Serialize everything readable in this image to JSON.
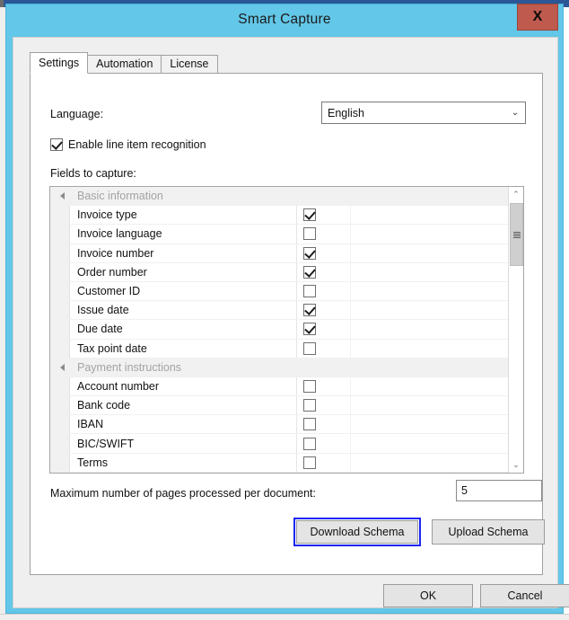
{
  "window": {
    "title": "Smart Capture",
    "close_label": "X",
    "frame_color": "#62c7e8",
    "close_button_color": "#bf5a4e"
  },
  "tabs": [
    {
      "label": "Settings",
      "active": true
    },
    {
      "label": "Automation",
      "active": false
    },
    {
      "label": "License",
      "active": false
    }
  ],
  "settings": {
    "language_label": "Language:",
    "language_value": "English",
    "language_arrow": "⌄",
    "enable_line_item_label": "Enable line item recognition",
    "enable_line_item_checked": true,
    "fields_label": "Fields to capture:",
    "maxpages_label": "Maximum number of pages processed per document:",
    "maxpages_value": "5",
    "download_schema_label": "Download Schema",
    "upload_schema_label": "Upload Schema",
    "focus_ring_color": "#1d24f0"
  },
  "field_list": {
    "rows": [
      {
        "type": "group",
        "label": "Basic information"
      },
      {
        "type": "item",
        "label": "Invoice type",
        "checked": true
      },
      {
        "type": "item",
        "label": "Invoice language",
        "checked": false
      },
      {
        "type": "item",
        "label": "Invoice number",
        "checked": true
      },
      {
        "type": "item",
        "label": "Order number",
        "checked": true
      },
      {
        "type": "item",
        "label": "Customer ID",
        "checked": false
      },
      {
        "type": "item",
        "label": "Issue date",
        "checked": true
      },
      {
        "type": "item",
        "label": "Due date",
        "checked": true
      },
      {
        "type": "item",
        "label": "Tax point date",
        "checked": false
      },
      {
        "type": "group",
        "label": "Payment instructions"
      },
      {
        "type": "item",
        "label": "Account number",
        "checked": false
      },
      {
        "type": "item",
        "label": "Bank code",
        "checked": false
      },
      {
        "type": "item",
        "label": "IBAN",
        "checked": false
      },
      {
        "type": "item",
        "label": "BIC/SWIFT",
        "checked": false
      },
      {
        "type": "item",
        "label": "Terms",
        "checked": false
      },
      {
        "type": "item",
        "label": "",
        "checked": false
      }
    ],
    "scrollbar": {
      "up_arrow": "⌃",
      "down_arrow": "⌄"
    }
  },
  "footer": {
    "ok_label": "OK",
    "cancel_label": "Cancel"
  }
}
